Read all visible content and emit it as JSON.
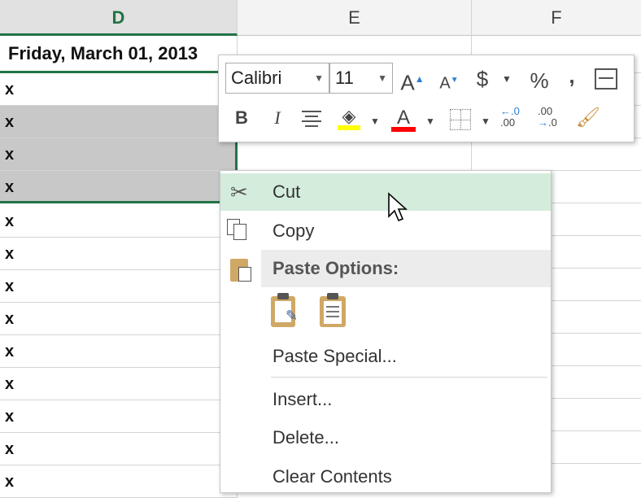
{
  "columns": {
    "d": "D",
    "e": "E",
    "f": "F"
  },
  "date_cell": "Friday, March 01, 2013",
  "rows": [
    "x",
    "x",
    "x",
    "x",
    "x",
    "x",
    "x",
    "x",
    "x",
    "x",
    "x",
    "x",
    "x"
  ],
  "mini_toolbar": {
    "font_name": "Calibri",
    "font_size": "11",
    "grow_font": "A",
    "shrink_font": "A",
    "currency": "$",
    "percent": "%",
    "comma": ",",
    "bold": "B",
    "italic": "I",
    "font_color": "A",
    "increase_decimal": ".00",
    "decrease_decimal": ".0",
    "highlight_color": "#ffff00",
    "font_color_value": "#ff0000"
  },
  "context_menu": {
    "cut": "Cut",
    "copy": "Copy",
    "paste_options": "Paste Options:",
    "paste_special": "Paste Special...",
    "insert": "Insert...",
    "delete": "Delete...",
    "clear_contents": "Clear Contents"
  },
  "colors": {
    "accent": "#217346",
    "hover": "#d4ecdc",
    "selection": "#c8c8c8"
  }
}
